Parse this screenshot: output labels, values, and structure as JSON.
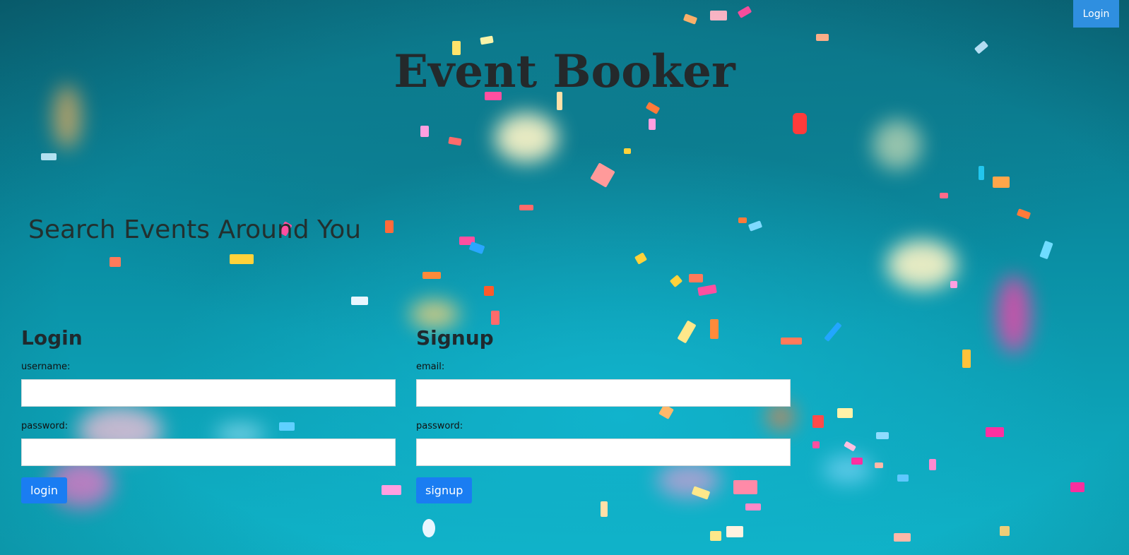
{
  "header": {
    "login_button": "Login"
  },
  "hero": {
    "title": "Event Booker",
    "subtitle": "Search Events Around You"
  },
  "login_form": {
    "heading": "Login",
    "username_label": "username:",
    "username_value": "",
    "password_label": "password:",
    "password_value": "",
    "submit_label": "login"
  },
  "signup_form": {
    "heading": "Signup",
    "email_label": "email:",
    "email_value": "",
    "password_label": "password:",
    "password_value": "",
    "submit_label": "signup"
  },
  "colors": {
    "accent": "#1a7df2",
    "header_button": "#2f8fe0",
    "background": "#0a8ea3"
  }
}
